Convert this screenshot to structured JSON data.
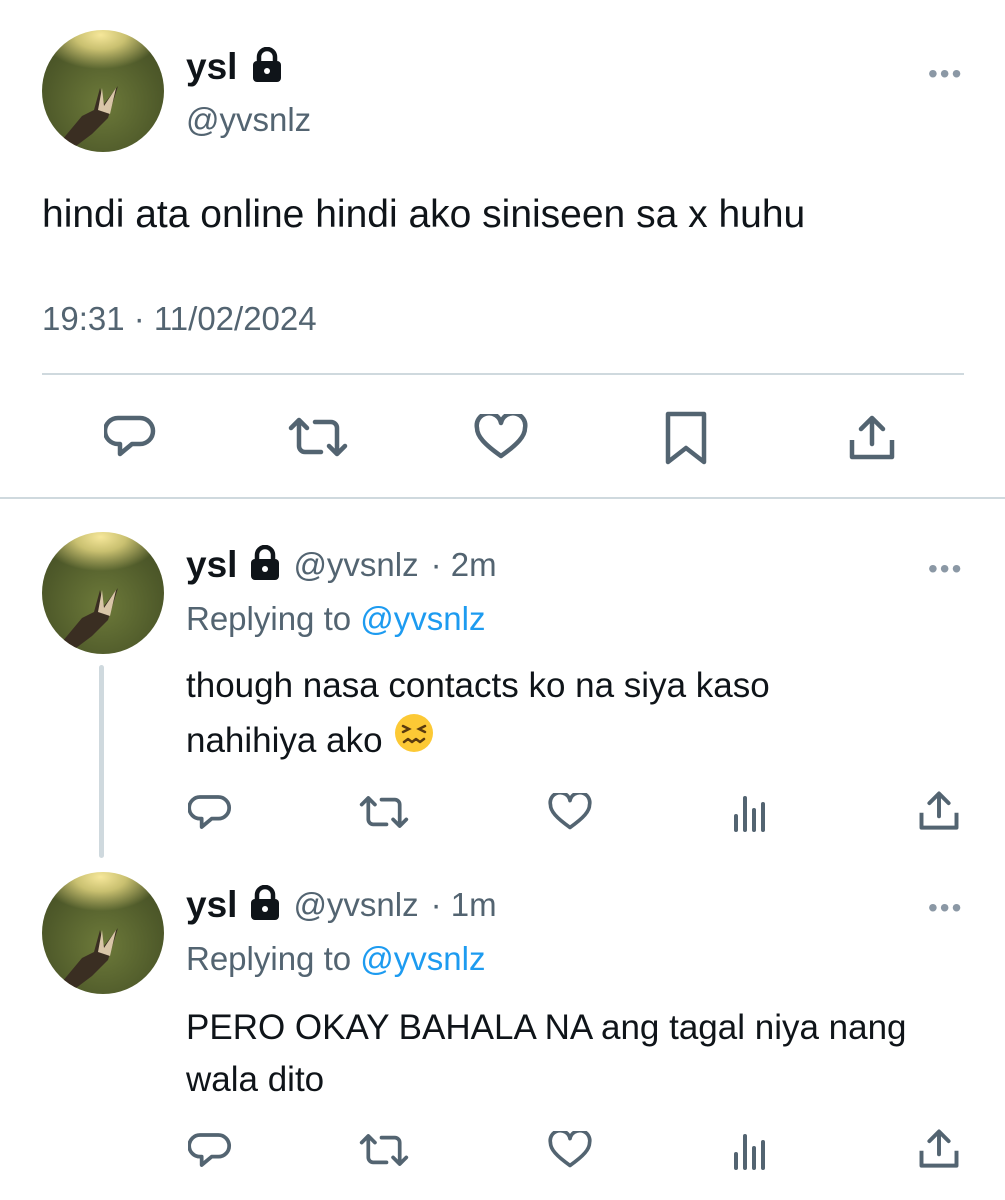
{
  "main_tweet": {
    "display_name": "ysl",
    "handle": "@yvsnlz",
    "text": "hindi ata online hindi ako siniseen sa x huhu",
    "timestamp": "19:31 · 11/02/2024"
  },
  "replies": [
    {
      "display_name": "ysl",
      "handle": "@yvsnlz",
      "time": "· 2m",
      "replying_prefix": "Replying to",
      "replying_to": "@yvsnlz",
      "text": "though nasa contacts ko na siya kaso",
      "text_line2": "nahihiya ako"
    },
    {
      "display_name": "ysl",
      "handle": "@yvsnlz",
      "time": "· 1m",
      "replying_prefix": "Replying to",
      "replying_to": "@yvsnlz",
      "text": "PERO OKAY BAHALA NA ang tagal niya nang",
      "text_line2": "wala dito"
    }
  ],
  "more_label": "•••",
  "icons": {
    "lock": "lock-icon",
    "emoji": "confounded-face-emoji",
    "actions_main": [
      "reply-icon",
      "retweet-icon",
      "like-icon",
      "bookmark-icon",
      "share-icon"
    ],
    "actions_reply": [
      "reply-icon",
      "retweet-icon",
      "like-icon",
      "views-icon",
      "share-icon"
    ]
  },
  "colors": {
    "text": "#0f1419",
    "secondary": "#536471",
    "link": "#1d9bf0",
    "divider": "#cfd9de"
  }
}
